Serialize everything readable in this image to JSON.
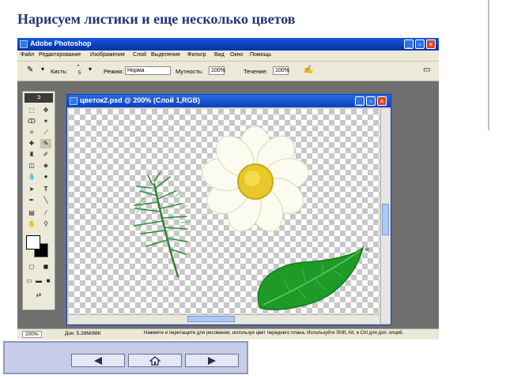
{
  "slide": {
    "title": "Нарисуем листики и еще несколько цветов"
  },
  "app": {
    "title": "Adobe Photoshop",
    "menu": [
      "Файл",
      "Редактирование",
      "Изображение",
      "Слой",
      "Выделение",
      "Фильтр",
      "Вид",
      "Окно",
      "Помощь"
    ]
  },
  "options": {
    "brush_label": "Кисть:",
    "brush_size": "5",
    "mode_label": "Режим:",
    "mode_value": "Норма",
    "opacity_label": "Мутность:",
    "opacity_value": "100%",
    "flow_label": "Течение:",
    "flow_value": "100%"
  },
  "document": {
    "title": "цветок2.psd @ 200% (Слой 1,RGB)"
  },
  "status": {
    "zoom": "200%",
    "doc_size": "Док: 5,39M/88K",
    "hint": "Нажмите и перетащите для рисования, используя цвет переднего плана. Используйте Shift, Alt, и Ctrl для доп. опций."
  },
  "colors": {
    "title_color": "#23357a",
    "titlebar_blue": "#0a3fc0",
    "leaf_green": "#1e9a28",
    "flower_center": "#e7c828"
  },
  "icons": {
    "nav_prev": "left-arrow-icon",
    "nav_home": "home-icon",
    "nav_next": "right-arrow-icon"
  }
}
